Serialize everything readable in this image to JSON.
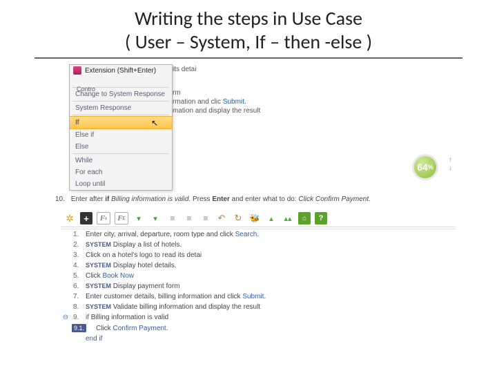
{
  "title_line1": "Writing the steps in Use Case",
  "title_line2": "( User – System, If – then -else )",
  "bg": {
    "l1": "its detai",
    "l2": "rm",
    "l3a": "rmation and clic ",
    "l3b": "Submit",
    "l3c": ".",
    "l4": "mation and display the result"
  },
  "ctx": {
    "ext": "Extension (Shift+Enter)",
    "contro": "Contro",
    "change": "Change to System Response",
    "sysresp": "System Response",
    "if": "If",
    "elseif": "Else if",
    "else": "Else",
    "while": "While",
    "foreach": "For each",
    "loopuntil": "Loop until"
  },
  "badge": {
    "value": "64",
    "unit": "%"
  },
  "instr": {
    "num": "10.",
    "p1": "Enter after ",
    "p1b": "if",
    "p2": " Billing information is valid.",
    "p3": " Press ",
    "p3b": "Enter",
    "p4": " and enter what to do: ",
    "p4i": "Click Confirm Payment."
  },
  "steps": [
    {
      "n": "1.",
      "pre": "",
      "text": "Enter city, arrival, departure, room type and click ",
      "link": "Search",
      "post": "."
    },
    {
      "n": "2.",
      "pre": "SYSTEM",
      "text": " Display a list of hotels."
    },
    {
      "n": "3.",
      "pre": "",
      "text": "Click on a hotel's logo to read its detai"
    },
    {
      "n": "4.",
      "pre": "SYSTEM",
      "text": " Display hotel details."
    },
    {
      "n": "5.",
      "pre": "",
      "text": "Click ",
      "link": "Book Now"
    },
    {
      "n": "6.",
      "pre": "SYSTEM",
      "text": " Display payment form"
    },
    {
      "n": "7.",
      "pre": "",
      "text": "Enter customer details, billing information and click ",
      "link": "Submit",
      "post": "."
    },
    {
      "n": "8.",
      "pre": "SYSTEM",
      "text": " Validate billing information and display the result"
    },
    {
      "n": "9.",
      "kw": "if",
      "text": " Billing information is valid",
      "collapse": true
    },
    {
      "n": "9.1.",
      "boxed": true,
      "text": "Click ",
      "link": "Confirm Payment",
      "post": ".",
      "indent": true
    },
    {
      "n": "",
      "kw": "end if",
      "indent": true
    }
  ]
}
